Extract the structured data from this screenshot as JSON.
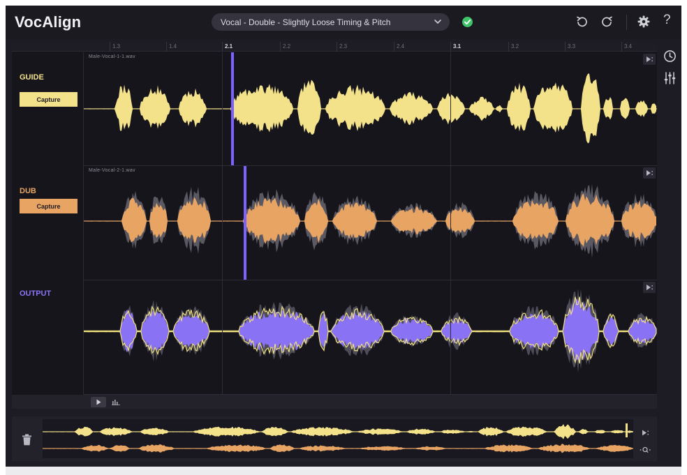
{
  "header": {
    "app_title": "VocAlign",
    "preset": "Vocal - Double - Slightly Loose Timing & Pitch",
    "icons": [
      "chevron-down-icon",
      "check-circle-icon",
      "undo-icon",
      "redo-icon",
      "gear-icon",
      "help-icon"
    ],
    "help_glyph": "?"
  },
  "ruler": {
    "ticks": [
      {
        "label": "1.3",
        "major": false
      },
      {
        "label": "1.4",
        "major": false
      },
      {
        "label": "2.1",
        "major": true
      },
      {
        "label": "2.2",
        "major": false
      },
      {
        "label": "2.3",
        "major": false
      },
      {
        "label": "2.4",
        "major": false
      },
      {
        "label": "3.1",
        "major": true
      },
      {
        "label": "3.2",
        "major": false
      },
      {
        "label": "3.3",
        "major": false
      },
      {
        "label": "3.4",
        "major": false
      }
    ]
  },
  "tracks": {
    "guide": {
      "label": "GUIDE",
      "capture_label": "Capture",
      "file_name": "Male-Vocal-1-1.wav",
      "color": "#f3e28a"
    },
    "dub": {
      "label": "DUB",
      "capture_label": "Capture",
      "file_name": "Male-Vocal-2-1.wav",
      "color": "#e8a462"
    },
    "output": {
      "label": "OUTPUT",
      "color": "#8a72f4",
      "outline_color": "#efe07e"
    }
  },
  "colors": {
    "playhead": "#7a63ff",
    "background": "#16151c",
    "header": "#1b1a21"
  },
  "sidebar": {
    "icons": [
      "clock-icon",
      "mixer-icon"
    ]
  },
  "transport": {
    "icons": [
      "play-icon",
      "meter-icon"
    ]
  },
  "overview": {
    "icons": [
      "trash-icon",
      "play-selection-icon",
      "zoom-icon"
    ]
  }
}
